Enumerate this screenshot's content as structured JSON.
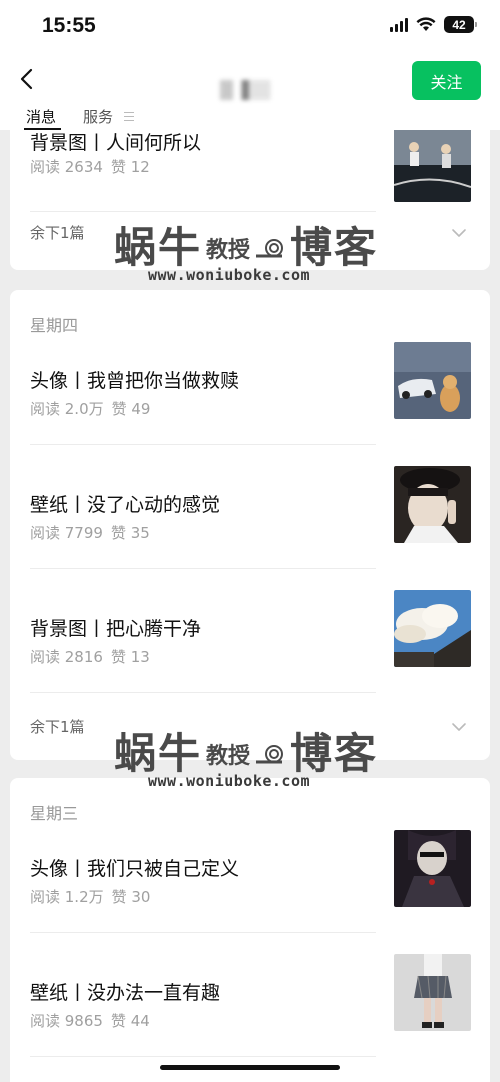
{
  "status_bar": {
    "time": "15:55",
    "battery": "42"
  },
  "nav": {
    "follow_label": "关注"
  },
  "tabs": {
    "messages": "消息",
    "services": "服务"
  },
  "cards": [
    {
      "articles": [
        {
          "title": "背景图丨人间何所以",
          "reads": "阅读 2634",
          "likes": "赞 12"
        }
      ],
      "more": "余下1篇"
    },
    {
      "day": "星期四",
      "articles": [
        {
          "title": "头像丨我曾把你当做救赎",
          "reads": "阅读 2.0万",
          "likes": "赞 49"
        },
        {
          "title": "壁纸丨没了心动的感觉",
          "reads": "阅读 7799",
          "likes": "赞 35"
        },
        {
          "title": "背景图丨把心腾干净",
          "reads": "阅读 2816",
          "likes": "赞 13"
        }
      ],
      "more": "余下1篇"
    },
    {
      "day": "星期三",
      "articles": [
        {
          "title": "头像丨我们只被自己定义",
          "reads": "阅读 1.2万",
          "likes": "赞 30"
        },
        {
          "title": "壁纸丨没办法一直有趣",
          "reads": "阅读 9865",
          "likes": "赞 44"
        }
      ]
    }
  ],
  "watermark": {
    "name_big_1": "蜗牛",
    "name_small": "教授",
    "name_big_2": "博客",
    "url": "www.woniuboke.com"
  },
  "colors": {
    "accent": "#07c160",
    "background": "#ededed"
  }
}
